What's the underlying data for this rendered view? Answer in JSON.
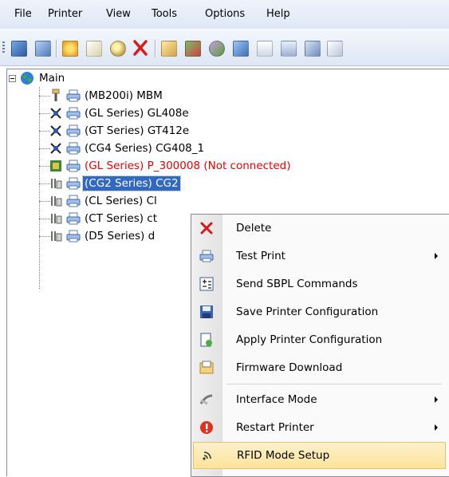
{
  "menubar": {
    "file": "File",
    "printer": "Printer",
    "view": "View",
    "tools": "Tools",
    "options": "Options",
    "help": "Help"
  },
  "toolbar": {
    "icons": [
      "add-printer-icon",
      "network-printer-icon",
      "properties-icon",
      "print-preview-icon",
      "search-printer-icon",
      "delete-icon",
      "folder-open-icon",
      "image-icon",
      "firmware-icon",
      "picture-icon",
      "sbpl-icon",
      "network-tree-icon",
      "save-icon",
      "document-icon"
    ]
  },
  "tree": {
    "root": "Main",
    "printers": [
      {
        "label": "(MB200i) MBM",
        "connection": "usb"
      },
      {
        "label": "(GL Series) GL408e",
        "connection": "lan"
      },
      {
        "label": "(GT Series) GT412e",
        "connection": "lan"
      },
      {
        "label": "(CG4 Series) CG408_1",
        "connection": "lan"
      },
      {
        "label": "(GL Series) P_300008 (Not connected)",
        "connection": "board",
        "status": "not-connected"
      },
      {
        "label": "(CG2 Series) CG2",
        "connection": "serial",
        "selected": true
      },
      {
        "label": "(CL Series) Cl",
        "connection": "serial"
      },
      {
        "label": "(CT Series) ct",
        "connection": "serial"
      },
      {
        "label": "(D5 Series) d",
        "connection": "serial"
      }
    ]
  },
  "context_menu": {
    "items": [
      {
        "label": "Delete",
        "icon": "delete-x-icon"
      },
      {
        "label": "Test Print",
        "icon": "printer-icon",
        "submenu": true
      },
      {
        "label": "Send SBPL Commands",
        "icon": "sbpl-command-icon"
      },
      {
        "label": "Save Printer Configuration",
        "icon": "floppy-save-icon"
      },
      {
        "label": "Apply Printer Configuration",
        "icon": "apply-config-icon"
      },
      {
        "label": "Firmware Download",
        "icon": "firmware-download-icon"
      },
      {
        "label": "Interface Mode",
        "icon": "interface-cable-icon",
        "submenu": true
      },
      {
        "label": "Restart Printer",
        "icon": "restart-alert-icon",
        "submenu": true
      },
      {
        "label": "RFID Mode Setup",
        "icon": "rfid-signal-icon",
        "highlighted": true
      }
    ]
  },
  "colors": {
    "selection": "#3168c2",
    "not_connected": "#ee0000",
    "menu_highlight": "#fbe39b"
  }
}
